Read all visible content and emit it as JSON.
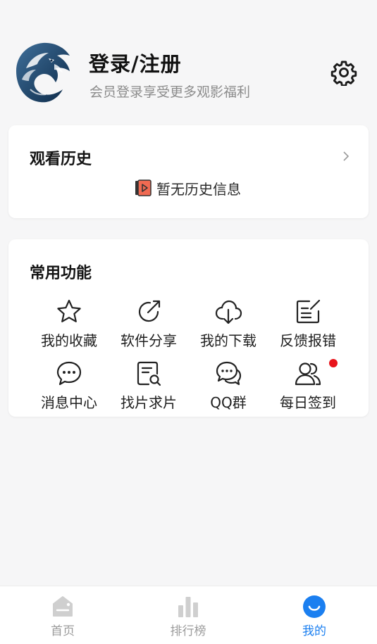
{
  "header": {
    "title": "登录/注册",
    "subtitle": "会员登录享受更多观影福利"
  },
  "history": {
    "title": "观看历史",
    "empty_text": "暂无历史信息"
  },
  "functions": {
    "title": "常用功能",
    "items": [
      {
        "label": "我的收藏",
        "icon": "star-icon"
      },
      {
        "label": "软件分享",
        "icon": "share-icon"
      },
      {
        "label": "我的下载",
        "icon": "cloud-download-icon"
      },
      {
        "label": "反馈报错",
        "icon": "feedback-edit-icon"
      },
      {
        "label": "消息中心",
        "icon": "message-icon"
      },
      {
        "label": "找片求片",
        "icon": "search-document-icon"
      },
      {
        "label": "QQ群",
        "icon": "chat-bubbles-icon"
      },
      {
        "label": "每日签到",
        "icon": "users-icon"
      }
    ]
  },
  "nav": {
    "items": [
      {
        "label": "首页",
        "icon": "home-icon"
      },
      {
        "label": "排行榜",
        "icon": "ranking-icon"
      },
      {
        "label": "我的",
        "icon": "profile-icon",
        "active": true
      }
    ]
  },
  "colors": {
    "accent": "#1b7ff0",
    "badge": "#e8141b",
    "background": "#f6f6f7"
  }
}
